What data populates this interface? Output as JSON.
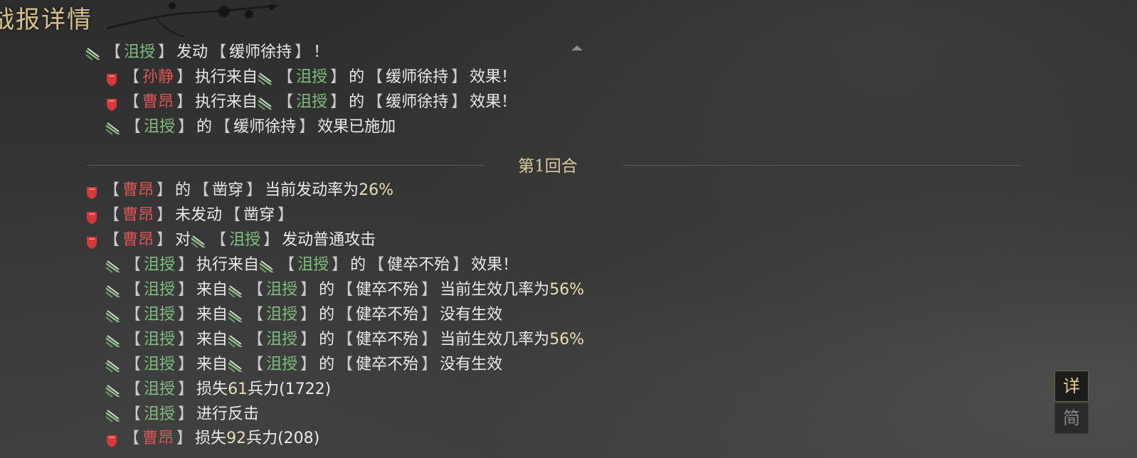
{
  "header": {
    "title": "战报详情"
  },
  "round": {
    "label": "第1回合"
  },
  "side_buttons": {
    "detail": "详",
    "simple": "简"
  },
  "colors": {
    "qun_name": "#7fbf7f",
    "wei_name": "#e05454",
    "number": "#e7dfb0",
    "round_label": "#d8c89a"
  },
  "log": [
    {
      "indent": 0,
      "parts": [
        {
          "t": "icon",
          "v": "qun-banner-icon"
        },
        {
          "t": "name",
          "c": "g",
          "v": "沮授"
        },
        {
          "t": "text",
          "v": "发动"
        },
        {
          "t": "skill",
          "v": "缓师徐持"
        },
        {
          "t": "text",
          "v": "！"
        }
      ]
    },
    {
      "indent": 1,
      "parts": [
        {
          "t": "icon",
          "v": "wei-shield-icon"
        },
        {
          "t": "name",
          "c": "r",
          "v": "孙静"
        },
        {
          "t": "text",
          "v": "执行来自"
        },
        {
          "t": "icon",
          "v": "qun-banner-icon"
        },
        {
          "t": "name",
          "c": "g",
          "v": "沮授"
        },
        {
          "t": "text",
          "v": "的"
        },
        {
          "t": "skill",
          "v": "缓师徐持"
        },
        {
          "t": "text",
          "v": "效果！"
        }
      ]
    },
    {
      "indent": 1,
      "parts": [
        {
          "t": "icon",
          "v": "wei-shield-icon"
        },
        {
          "t": "name",
          "c": "r",
          "v": "曹昂"
        },
        {
          "t": "text",
          "v": "执行来自"
        },
        {
          "t": "icon",
          "v": "qun-banner-icon"
        },
        {
          "t": "name",
          "c": "g",
          "v": "沮授"
        },
        {
          "t": "text",
          "v": "的"
        },
        {
          "t": "skill",
          "v": "缓师徐持"
        },
        {
          "t": "text",
          "v": "效果！"
        }
      ]
    },
    {
      "indent": 1,
      "parts": [
        {
          "t": "icon",
          "v": "qun-banner-icon"
        },
        {
          "t": "name",
          "c": "g",
          "v": "沮授"
        },
        {
          "t": "text",
          "v": "的"
        },
        {
          "t": "skill",
          "v": "缓师徐持"
        },
        {
          "t": "text",
          "v": "效果已施加"
        }
      ]
    },
    {
      "indent": 0,
      "parts": [
        {
          "t": "icon",
          "v": "wei-shield-icon"
        },
        {
          "t": "name",
          "c": "r",
          "v": "曹昂"
        },
        {
          "t": "text",
          "v": "的"
        },
        {
          "t": "skill",
          "v": "凿穿"
        },
        {
          "t": "text",
          "v": "当前发动率为"
        },
        {
          "t": "num",
          "v": "26%"
        }
      ]
    },
    {
      "indent": 0,
      "parts": [
        {
          "t": "icon",
          "v": "wei-shield-icon"
        },
        {
          "t": "name",
          "c": "r",
          "v": "曹昂"
        },
        {
          "t": "text",
          "v": "未发动"
        },
        {
          "t": "skill",
          "v": "凿穿"
        }
      ]
    },
    {
      "indent": 0,
      "parts": [
        {
          "t": "icon",
          "v": "wei-shield-icon"
        },
        {
          "t": "name",
          "c": "r",
          "v": "曹昂"
        },
        {
          "t": "text",
          "v": "对"
        },
        {
          "t": "icon",
          "v": "qun-banner-icon"
        },
        {
          "t": "name",
          "c": "g",
          "v": "沮授"
        },
        {
          "t": "text",
          "v": "发动普通攻击"
        }
      ]
    },
    {
      "indent": 1,
      "parts": [
        {
          "t": "icon",
          "v": "qun-banner-icon"
        },
        {
          "t": "name",
          "c": "g",
          "v": "沮授"
        },
        {
          "t": "text",
          "v": "执行来自"
        },
        {
          "t": "icon",
          "v": "qun-banner-icon"
        },
        {
          "t": "name",
          "c": "g",
          "v": "沮授"
        },
        {
          "t": "text",
          "v": "的"
        },
        {
          "t": "skill",
          "v": "健卒不殆"
        },
        {
          "t": "text",
          "v": "效果！"
        }
      ]
    },
    {
      "indent": 1,
      "parts": [
        {
          "t": "icon",
          "v": "qun-banner-icon"
        },
        {
          "t": "name",
          "c": "g",
          "v": "沮授"
        },
        {
          "t": "text",
          "v": "来自"
        },
        {
          "t": "icon",
          "v": "qun-banner-icon"
        },
        {
          "t": "name",
          "c": "g",
          "v": "沮授"
        },
        {
          "t": "text",
          "v": "的"
        },
        {
          "t": "skill",
          "v": "健卒不殆"
        },
        {
          "t": "text",
          "v": "当前生效几率为"
        },
        {
          "t": "num",
          "v": "56%"
        }
      ]
    },
    {
      "indent": 1,
      "parts": [
        {
          "t": "icon",
          "v": "qun-banner-icon"
        },
        {
          "t": "name",
          "c": "g",
          "v": "沮授"
        },
        {
          "t": "text",
          "v": "来自"
        },
        {
          "t": "icon",
          "v": "qun-banner-icon"
        },
        {
          "t": "name",
          "c": "g",
          "v": "沮授"
        },
        {
          "t": "text",
          "v": "的"
        },
        {
          "t": "skill",
          "v": "健卒不殆"
        },
        {
          "t": "text",
          "v": "没有生效"
        }
      ]
    },
    {
      "indent": 1,
      "parts": [
        {
          "t": "icon",
          "v": "qun-banner-icon"
        },
        {
          "t": "name",
          "c": "g",
          "v": "沮授"
        },
        {
          "t": "text",
          "v": "来自"
        },
        {
          "t": "icon",
          "v": "qun-banner-icon"
        },
        {
          "t": "name",
          "c": "g",
          "v": "沮授"
        },
        {
          "t": "text",
          "v": "的"
        },
        {
          "t": "skill",
          "v": "健卒不殆"
        },
        {
          "t": "text",
          "v": "当前生效几率为"
        },
        {
          "t": "num",
          "v": "56%"
        }
      ]
    },
    {
      "indent": 1,
      "parts": [
        {
          "t": "icon",
          "v": "qun-banner-icon"
        },
        {
          "t": "name",
          "c": "g",
          "v": "沮授"
        },
        {
          "t": "text",
          "v": "来自"
        },
        {
          "t": "icon",
          "v": "qun-banner-icon"
        },
        {
          "t": "name",
          "c": "g",
          "v": "沮授"
        },
        {
          "t": "text",
          "v": "的"
        },
        {
          "t": "skill",
          "v": "健卒不殆"
        },
        {
          "t": "text",
          "v": "没有生效"
        }
      ]
    },
    {
      "indent": 1,
      "parts": [
        {
          "t": "icon",
          "v": "qun-banner-icon"
        },
        {
          "t": "name",
          "c": "g",
          "v": "沮授"
        },
        {
          "t": "text",
          "v": "损失"
        },
        {
          "t": "num",
          "v": "61"
        },
        {
          "t": "text",
          "v": "兵力(1722)"
        }
      ]
    },
    {
      "indent": 1,
      "parts": [
        {
          "t": "icon",
          "v": "qun-banner-icon"
        },
        {
          "t": "name",
          "c": "g",
          "v": "沮授"
        },
        {
          "t": "text",
          "v": "进行反击"
        }
      ]
    },
    {
      "indent": 1,
      "parts": [
        {
          "t": "icon",
          "v": "wei-shield-icon"
        },
        {
          "t": "name",
          "c": "r",
          "v": "曹昂"
        },
        {
          "t": "text",
          "v": "损失"
        },
        {
          "t": "num",
          "v": "92"
        },
        {
          "t": "text",
          "v": "兵力(208)"
        }
      ]
    }
  ]
}
